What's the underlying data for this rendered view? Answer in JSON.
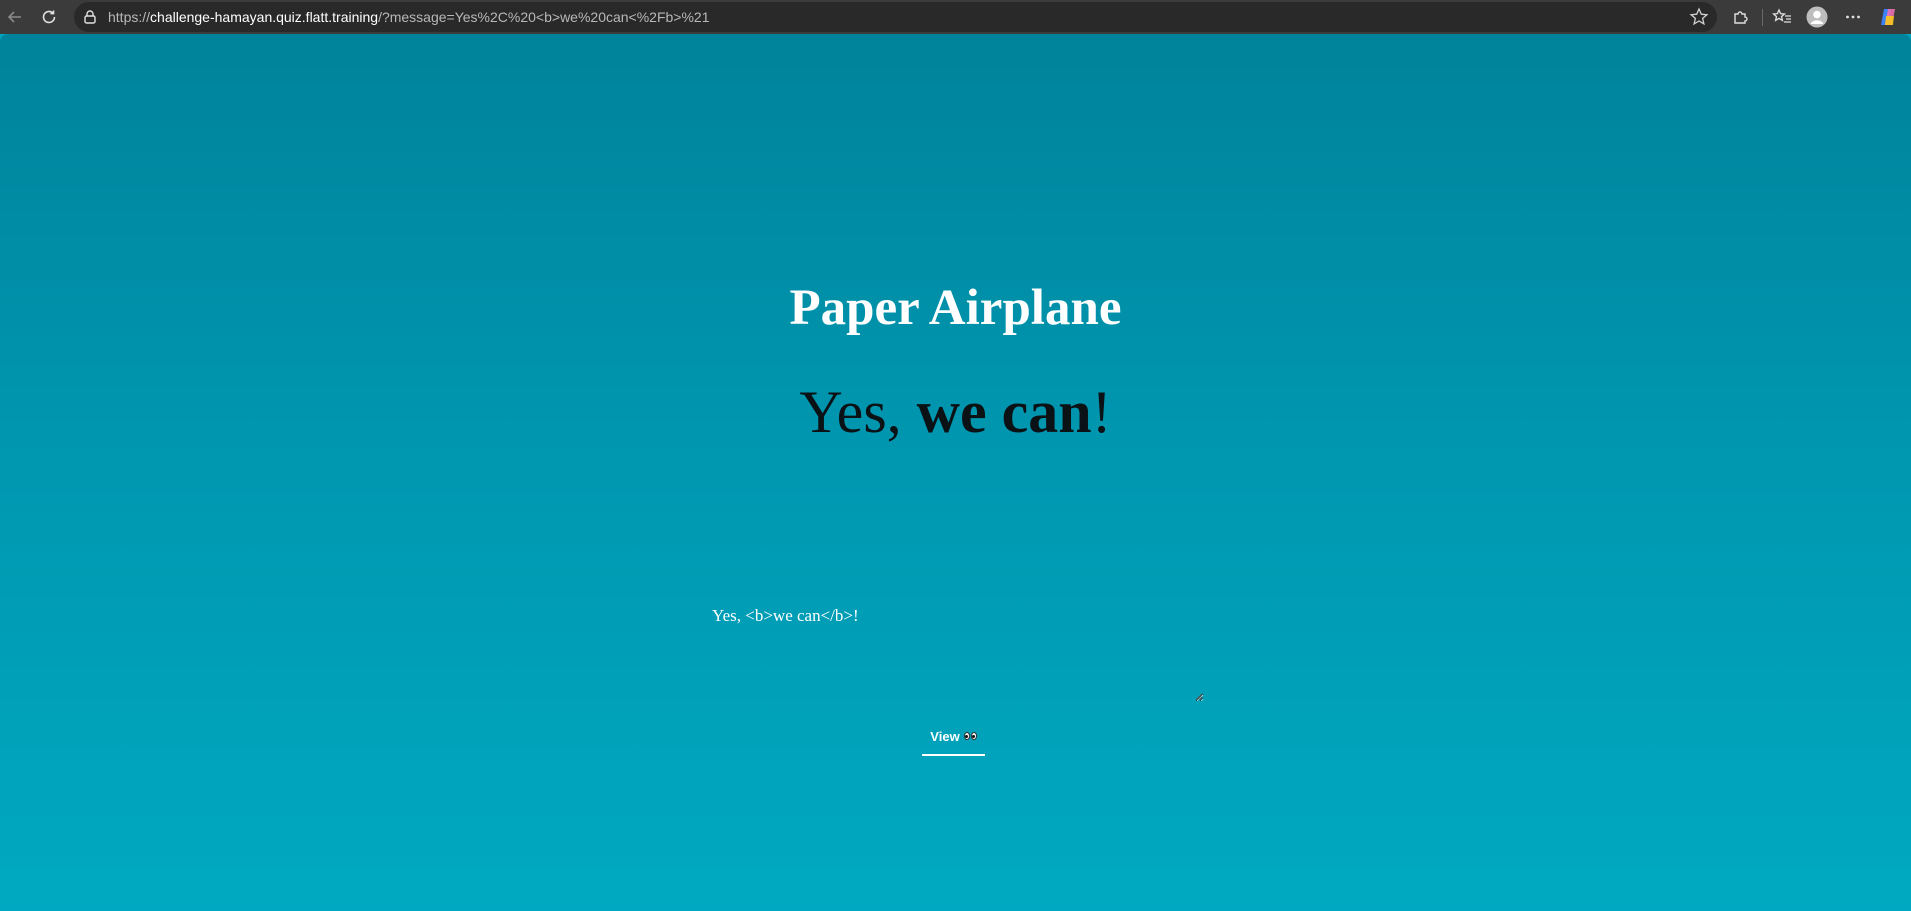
{
  "browser": {
    "url_scheme": "https://",
    "url_host": "challenge-hamayan.quiz.flatt.training",
    "url_path": "/?message=Yes%2C%20<b>we%20can<%2Fb>%21"
  },
  "page": {
    "title": "Paper Airplane",
    "message_prefix": "Yes, ",
    "message_bold": "we can",
    "message_suffix": "!"
  },
  "form": {
    "message_value": "Yes, <b>we can</b>!",
    "view_button_label": "View"
  },
  "colors": {
    "background_top": "#00839b",
    "background_bottom": "#00a9c1",
    "title": "#ffffff",
    "message_text": "#0b1216"
  },
  "icons": {
    "view_button": "eyes-icon"
  }
}
